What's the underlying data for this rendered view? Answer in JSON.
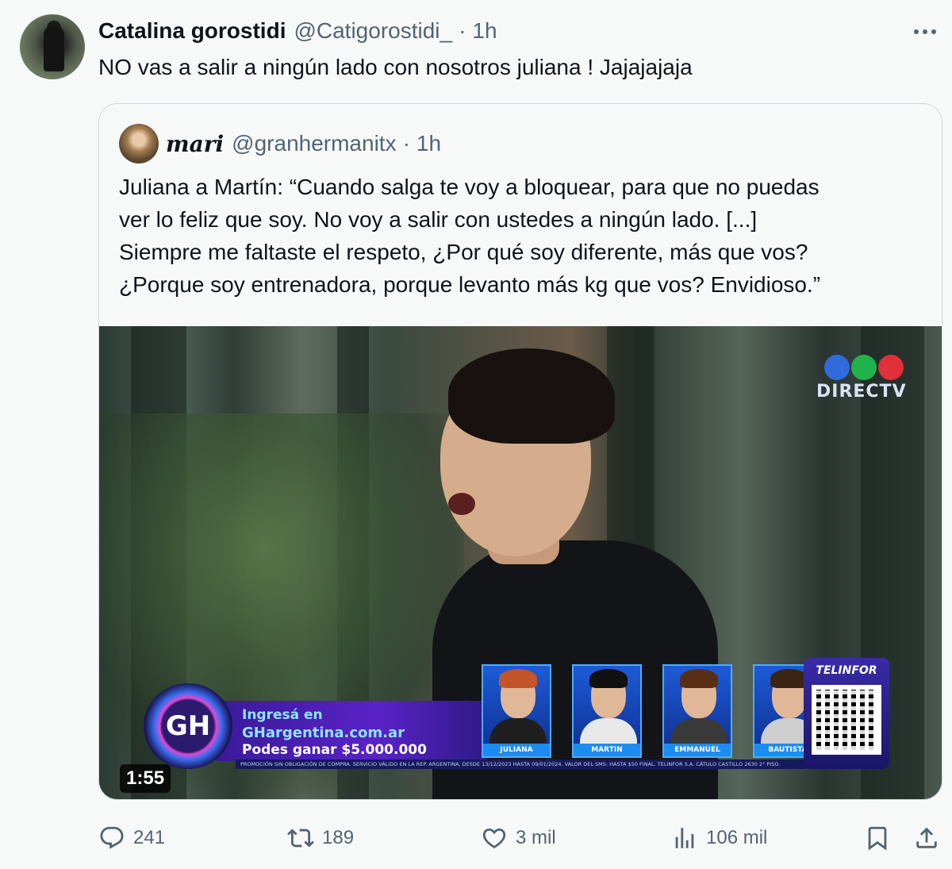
{
  "tweet": {
    "author_name": "Catalina gorostidi",
    "author_handle": "@Catigorostidi_",
    "separator": "·",
    "time": "1h",
    "text": "NO vas a salir a ningún lado con nosotros juliana ! Jajajajaja"
  },
  "quote": {
    "author_name": "mari",
    "author_handle": "@granhermanitx",
    "separator": "·",
    "time": "1h",
    "text_lines": [
      "Juliana a Martín: “Cuando salga te voy a bloquear, para que no puedas",
      "ver lo feliz que soy. No voy a salir con ustedes a ningún lado. [...]",
      "Siempre me faltaste el respeto, ¿Por qué soy diferente, más que vos?",
      "¿Porque soy entrenadora, porque levanto más kg que vos? Envidioso.”"
    ]
  },
  "video": {
    "duration": "1:55",
    "channel_logo": "DIRECTV",
    "logo_colors": [
      "#2f6bdc",
      "#22b24c",
      "#e0303a"
    ],
    "gh_logo": "GH",
    "banner_line1": "Ingresá en",
    "banner_line2": "GHargentina.com.ar",
    "banner_line3": "Podes ganar $5.000.000",
    "legal_text": "PROMOCIÓN SIN OBLIGACIÓN DE COMPRA. SERVICIO VÁLIDO EN LA REP. ARGENTINA, DESDE 13/12/2023 HASTA 09/01/2024. VALOR DEL SMS: HASTA $50 FINAL. TELINFOR S.A. CÁTULO CASTILLO 2630 2° PISO.",
    "contestants": [
      "JULIANA",
      "MARTIN",
      "EMMANUEL",
      "BAUTISTA"
    ],
    "sponsor": "TELINFOR"
  },
  "actions": {
    "replies": "241",
    "reposts": "189",
    "likes": "3 mil",
    "views": "106 mil",
    "icons": [
      "reply-icon",
      "repost-icon",
      "like-icon",
      "views-icon",
      "bookmark-icon",
      "share-icon"
    ]
  }
}
